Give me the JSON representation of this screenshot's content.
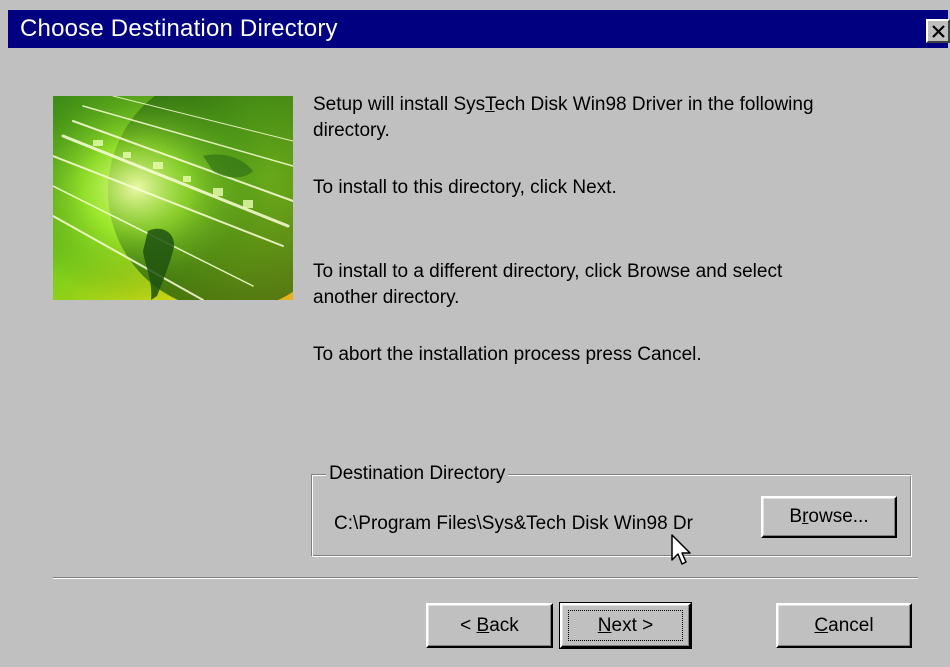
{
  "window": {
    "title": "Choose Destination Directory",
    "close_icon": "close-icon"
  },
  "content": {
    "intro_line1_pre": "Setup will install Sys",
    "intro_line1_accel": "T",
    "intro_line1_post": "ech Disk Win98 Driver in the following",
    "intro_line2": "directory.",
    "next_instruction": "To install to this directory, click Next.",
    "browse_instruction_line1": "To install to a different directory, click Browse and select",
    "browse_instruction_line2": "another directory.",
    "cancel_instruction": "To abort the installation process press Cancel."
  },
  "destination": {
    "group_label": "Destination Directory",
    "path": "C:\\Program Files\\Sys&Tech Disk Win98 Dr",
    "browse_pre": "B",
    "browse_accel": "r",
    "browse_post": "owse..."
  },
  "buttons": {
    "back_arrow": "< ",
    "back_accel": "B",
    "back_rest": "ack",
    "next_accel": "N",
    "next_rest": "ext >",
    "cancel_accel": "C",
    "cancel_rest": "ancel"
  },
  "colors": {
    "titlebar": "#000080",
    "dialog_bg": "#c0c0c0"
  }
}
